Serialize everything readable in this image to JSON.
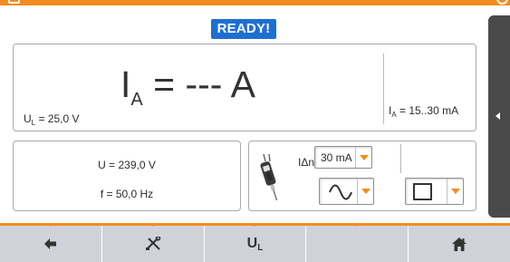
{
  "colors": {
    "accent_orange": "#f58b1f",
    "ready_blue": "#1f6fd1",
    "nav_gray": "#cfd3d9",
    "side_tab_dark": "#4a4a4a",
    "text_dark": "#2b2b2b"
  },
  "status": {
    "label": "READY!"
  },
  "result": {
    "symbol": "I",
    "subscript": "A",
    "value": "= --- A"
  },
  "contact_voltage": {
    "symbol": "U",
    "subscript": "L",
    "value": "= 25,0 V"
  },
  "trip_current_range": {
    "symbol": "I",
    "subscript": "A",
    "value": "= 15..30 mA"
  },
  "measurements": {
    "voltage": "U = 239,0 V",
    "frequency": "f = 50,0 Hz"
  },
  "settings": {
    "rcd_icon": "rcd-plug-icon",
    "idn_label": "IΔn",
    "idn_value": "30 mA",
    "waveform_icon": "sine-wave-icon",
    "rcd_type_icon": "square-icon"
  },
  "sidebar": {
    "expand_icon": "chevron-left-icon"
  },
  "navbar": {
    "buttons": [
      {
        "icon": "arrow-left-icon"
      },
      {
        "icon": "tools-icon"
      },
      {
        "symbol": "U",
        "subscript": "L"
      },
      {
        "icon": ""
      },
      {
        "icon": "home-icon"
      }
    ]
  }
}
